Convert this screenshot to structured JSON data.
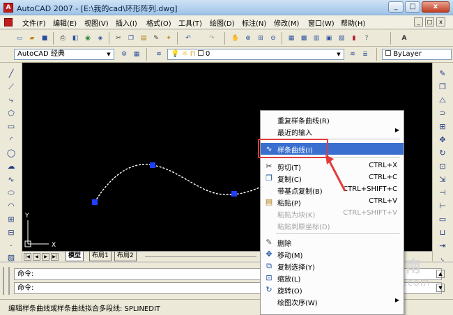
{
  "window": {
    "title": "AutoCAD 2007 - [E:\\我的cad\\环形阵列.dwg]",
    "controls": [
      "_",
      "□",
      "x"
    ],
    "doc_controls": [
      "_",
      "□",
      "x"
    ]
  },
  "menu": [
    "文件(F)",
    "编辑(E)",
    "视图(V)",
    "插入(I)",
    "格式(O)",
    "工具(T)",
    "绘图(D)",
    "标注(N)",
    "修改(M)",
    "窗口(W)",
    "帮助(H)"
  ],
  "workspace": {
    "name": "AutoCAD 经典",
    "layer_value": "0",
    "linetype": "ByLayer"
  },
  "canvas": {
    "ucs_x": "X",
    "ucs_y": "Y",
    "spline_color": "#ffffff",
    "grip_color": "#1f3fff"
  },
  "tabs": [
    "模型",
    "布局1",
    "布局2"
  ],
  "command": {
    "line1": "命令:",
    "line2": "命令:"
  },
  "status": {
    "text": "编辑样条曲线或样条曲线拟合多段线:  SPLINEDIT"
  },
  "context_menu": {
    "items": [
      {
        "label": "重复样条曲线(R)",
        "shortcut": "",
        "icon": "",
        "disabled": false,
        "submenu": false
      },
      {
        "label": "最近的输入",
        "shortcut": "",
        "icon": "",
        "disabled": false,
        "submenu": true
      },
      {
        "label": "样条曲线(I)",
        "shortcut": "",
        "icon": "spline-icon",
        "disabled": false,
        "submenu": false,
        "highlight": true
      },
      {
        "label": "剪切(T)",
        "shortcut": "CTRL+X",
        "icon": "scissors-icon",
        "disabled": false,
        "submenu": false
      },
      {
        "label": "复制(C)",
        "shortcut": "CTRL+C",
        "icon": "copy-icon",
        "disabled": false,
        "submenu": false
      },
      {
        "label": "带基点复制(B)",
        "shortcut": "CTRL+SHIFT+C",
        "icon": "",
        "disabled": false,
        "submenu": false
      },
      {
        "label": "粘贴(P)",
        "shortcut": "CTRL+V",
        "icon": "paste-icon",
        "disabled": false,
        "submenu": false
      },
      {
        "label": "粘贴为块(K)",
        "shortcut": "CTRL+SHIFT+V",
        "icon": "",
        "disabled": true,
        "submenu": false
      },
      {
        "label": "粘贴到原坐标(D)",
        "shortcut": "",
        "icon": "",
        "disabled": true,
        "submenu": false
      },
      {
        "label": "删除",
        "shortcut": "",
        "icon": "eraser-icon",
        "disabled": false,
        "submenu": false
      },
      {
        "label": "移动(M)",
        "shortcut": "",
        "icon": "move-icon",
        "disabled": false,
        "submenu": false
      },
      {
        "label": "复制选择(Y)",
        "shortcut": "",
        "icon": "copy-selection-icon",
        "disabled": false,
        "submenu": false
      },
      {
        "label": "缩放(L)",
        "shortcut": "",
        "icon": "scale-icon",
        "disabled": false,
        "submenu": false
      },
      {
        "label": "旋转(O)",
        "shortcut": "",
        "icon": "rotate-icon",
        "disabled": false,
        "submenu": false
      },
      {
        "label": "绘图次序(W)",
        "shortcut": "",
        "icon": "",
        "disabled": false,
        "submenu": true
      }
    ]
  },
  "watermark": {
    "text": "搜狗指南",
    "url": "zhinan.sogou.com"
  },
  "colors": {
    "highlight": "#3a6fd0",
    "callout": "#e23b3b"
  }
}
